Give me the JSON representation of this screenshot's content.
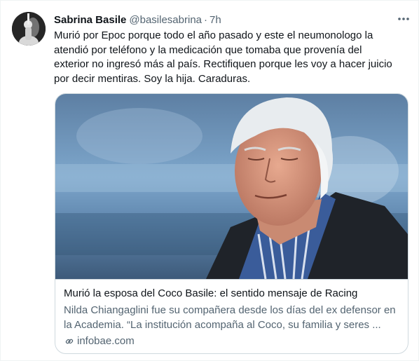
{
  "tweet": {
    "author_name": "Sabrina Basile",
    "author_handle": "@basilesabrina",
    "separator": "·",
    "time": "7h",
    "text": "Murió por Epoc porque todo el año pasado y este el neumonologo la atendió por teléfono y la medicación que tomaba que provenía del exterior no ingresó más al país. Rectifiquen porque les voy a hacer juicio por decir mentiras. Soy la hija. Caraduras.",
    "more_icon": "more-horizontal-icon"
  },
  "card": {
    "title": "Murió la esposa del Coco Basile: el sentido mensaje de Racing",
    "description": "Nilda Chiangaglini fue su compañera desde los días del ex defensor en la Academia. “La institución acompaña al Coco, su familia y seres ...",
    "domain": "infobae.com",
    "domain_icon": "link-icon"
  },
  "colors": {
    "text_primary": "#0f1419",
    "text_secondary": "#536471",
    "border": "#cfd9de"
  }
}
